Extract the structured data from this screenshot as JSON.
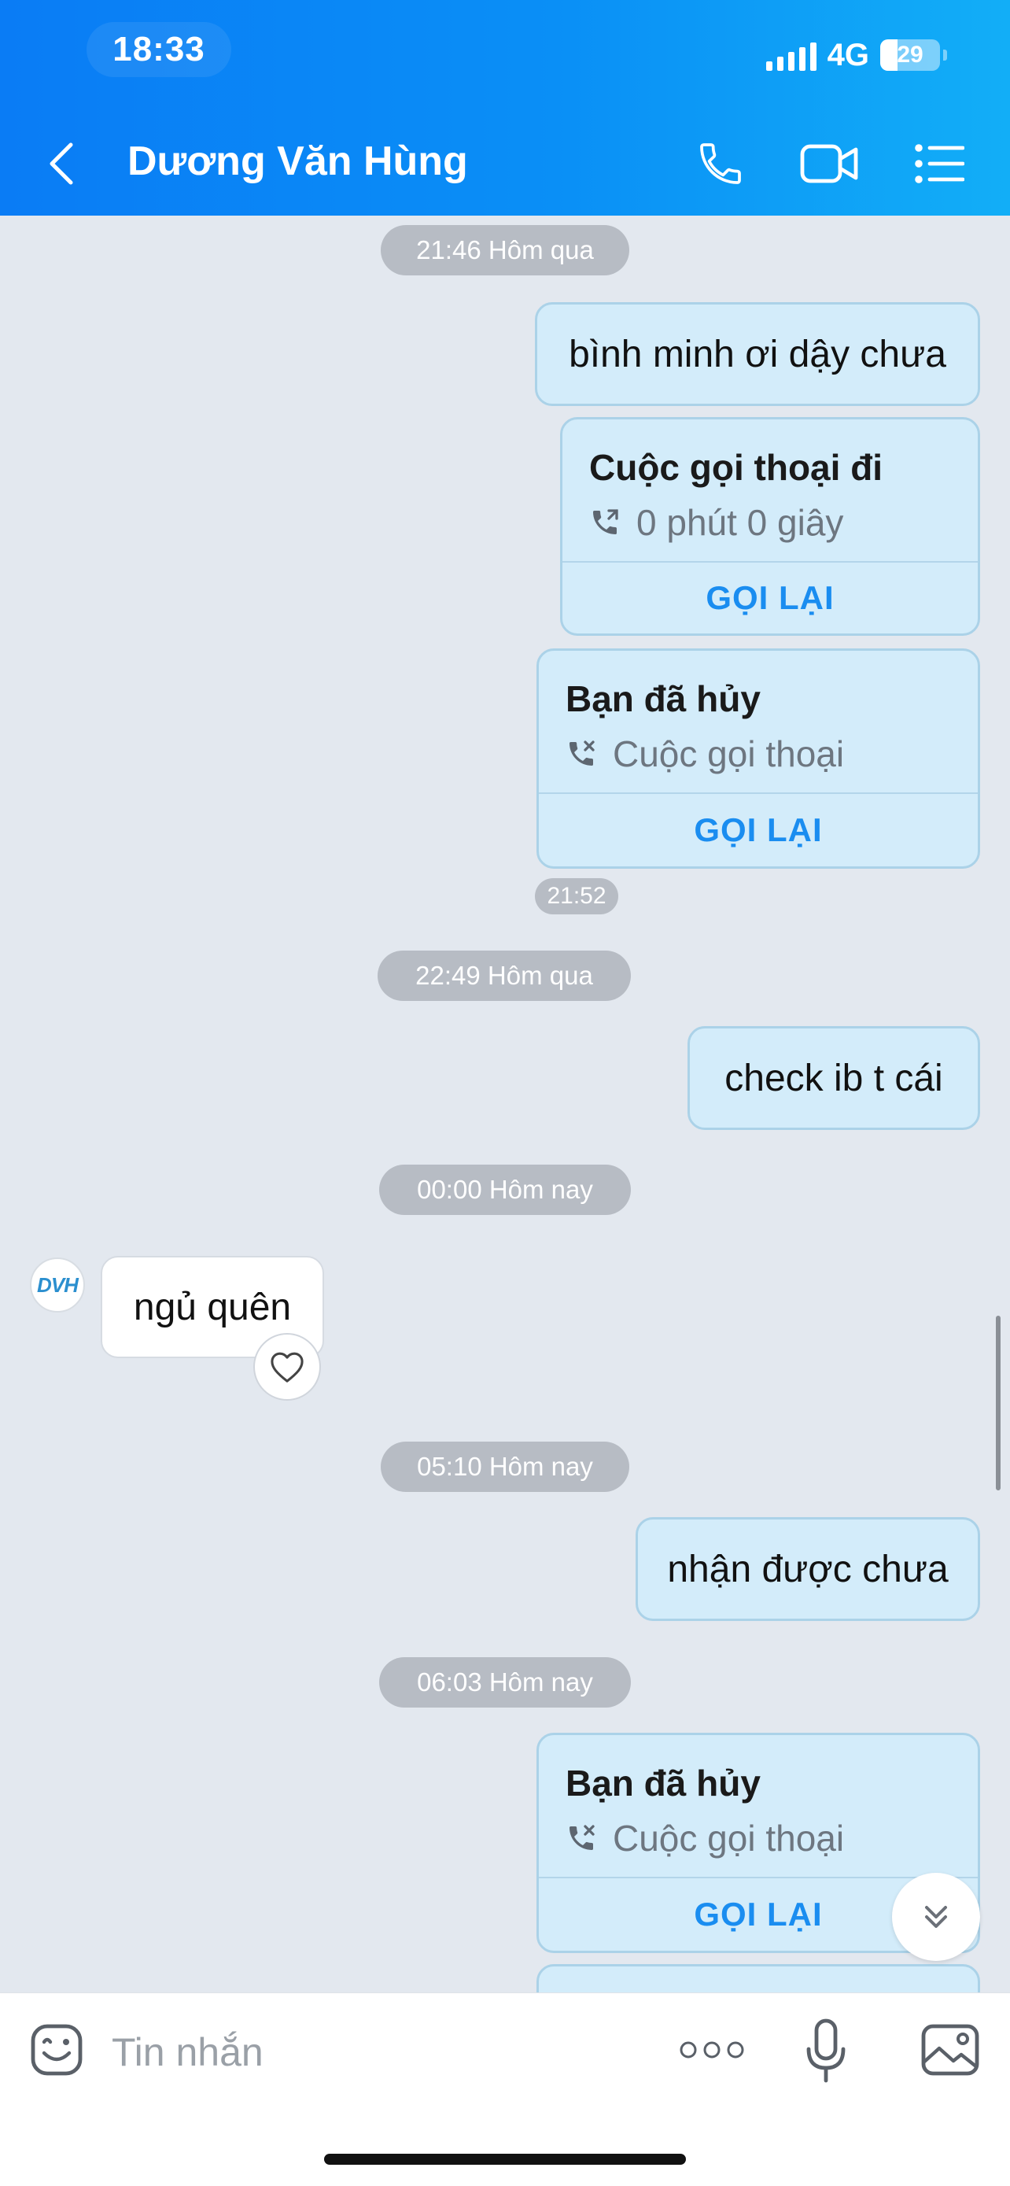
{
  "status": {
    "time": "18:33",
    "network": "4G",
    "battery": "29",
    "battery_level_percent": 29
  },
  "header": {
    "title": "Dương Văn Hùng",
    "icons": [
      "back-chevron-icon",
      "phone-icon",
      "video-camera-icon",
      "list-menu-icon"
    ]
  },
  "messages": [
    {
      "type": "time",
      "text": "21:46 Hôm qua"
    },
    {
      "type": "outgoing",
      "text": "bình minh ơi dậy chưa"
    },
    {
      "type": "call",
      "title": "Cuộc gọi thoại đi",
      "subtitle": "0 phút 0 giây",
      "action": "GỌI LẠI",
      "icon": "outgoing-call-icon"
    },
    {
      "type": "call",
      "title": "Bạn đã hủy",
      "subtitle": "Cuộc gọi thoại",
      "action": "GỌI LẠI",
      "icon": "cancelled-call-icon"
    },
    {
      "type": "time-small",
      "text": "21:52"
    },
    {
      "type": "time",
      "text": "22:49 Hôm qua"
    },
    {
      "type": "outgoing",
      "text": "check ib t cái"
    },
    {
      "type": "time",
      "text": "00:00 Hôm nay"
    },
    {
      "type": "incoming",
      "text": "ngủ quên",
      "avatar_text": "DVH"
    },
    {
      "type": "time",
      "text": "05:10 Hôm nay"
    },
    {
      "type": "outgoing",
      "text": "nhận được chưa"
    },
    {
      "type": "time",
      "text": "06:03 Hôm nay"
    },
    {
      "type": "call",
      "title": "Bạn đã hủy",
      "subtitle": "Cuộc gọi thoại",
      "action": "GỌI LẠI",
      "icon": "cancelled-call-icon"
    }
  ],
  "composer": {
    "placeholder": "Tin nhắn",
    "icons": [
      "sticker-icon",
      "more-dots-icon",
      "microphone-icon",
      "image-icon"
    ]
  },
  "colors": {
    "header_start": "#0a7cf5",
    "header_end": "#12aef7",
    "bubble_out": "#d3ecfa",
    "accent_link": "#1a8df0",
    "chat_bg": "#e3e8ef"
  }
}
